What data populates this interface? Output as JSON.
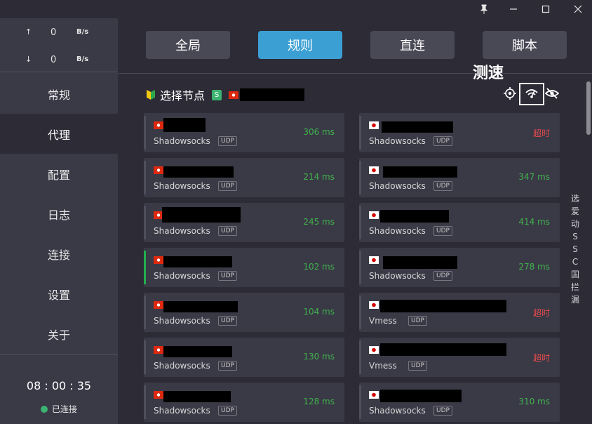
{
  "window_controls": {
    "pin": "📌",
    "minimize": "—",
    "maximize": "☐",
    "close": "✕"
  },
  "traffic": {
    "up": {
      "arrow": "↑",
      "value": "0",
      "unit": "B/s"
    },
    "down": {
      "arrow": "↓",
      "value": "0",
      "unit": "B/s"
    }
  },
  "nav": [
    {
      "label": "常规"
    },
    {
      "label": "代理"
    },
    {
      "label": "配置"
    },
    {
      "label": "日志"
    },
    {
      "label": "连接"
    },
    {
      "label": "设置"
    },
    {
      "label": "关于"
    }
  ],
  "clock": "08 : 00 : 35",
  "status": "已连接",
  "modes": [
    {
      "label": "全局"
    },
    {
      "label": "规则"
    },
    {
      "label": "直连"
    },
    {
      "label": "脚本"
    }
  ],
  "group": {
    "title": "选择节点",
    "type_badge": "S"
  },
  "annotation": "测速",
  "icons": {
    "locate": "locate-icon",
    "speedtest": "speedtest-icon",
    "hide": "eye-off-icon"
  },
  "proxies_left": [
    {
      "protocol": "Shadowsocks",
      "udp": "UDP",
      "delay": "306 ms"
    },
    {
      "protocol": "Shadowsocks",
      "udp": "UDP",
      "delay": "214 ms"
    },
    {
      "protocol": "Shadowsocks",
      "udp": "UDP",
      "delay": "245 ms"
    },
    {
      "protocol": "Shadowsocks",
      "udp": "UDP",
      "delay": "102 ms"
    },
    {
      "protocol": "Shadowsocks",
      "udp": "UDP",
      "delay": "104 ms"
    },
    {
      "protocol": "Shadowsocks",
      "udp": "UDP",
      "delay": "130 ms"
    },
    {
      "protocol": "Shadowsocks",
      "udp": "UDP",
      "delay": "128 ms"
    }
  ],
  "proxies_right": [
    {
      "protocol": "Shadowsocks",
      "udp": "UDP",
      "delay": "超时"
    },
    {
      "protocol": "Shadowsocks",
      "udp": "UDP",
      "delay": "347 ms"
    },
    {
      "protocol": "Shadowsocks",
      "udp": "UDP",
      "delay": "414 ms"
    },
    {
      "protocol": "Shadowsocks",
      "udp": "UDP",
      "delay": "278 ms"
    },
    {
      "protocol": "Vmess",
      "udp": "UDP",
      "delay": "超时"
    },
    {
      "protocol": "Vmess",
      "udp": "UDP",
      "delay": "超时"
    },
    {
      "protocol": "Shadowsocks",
      "udp": "UDP",
      "delay": "310 ms"
    }
  ],
  "side_letters": [
    "选",
    "爱",
    "动",
    "S",
    "S",
    "C",
    "国",
    "拦",
    "漏"
  ],
  "colors": {
    "accent": "#3b9fd4",
    "ok": "#3fb24c",
    "timeout": "#e84c4c",
    "selected_bar": "#22b14c"
  }
}
